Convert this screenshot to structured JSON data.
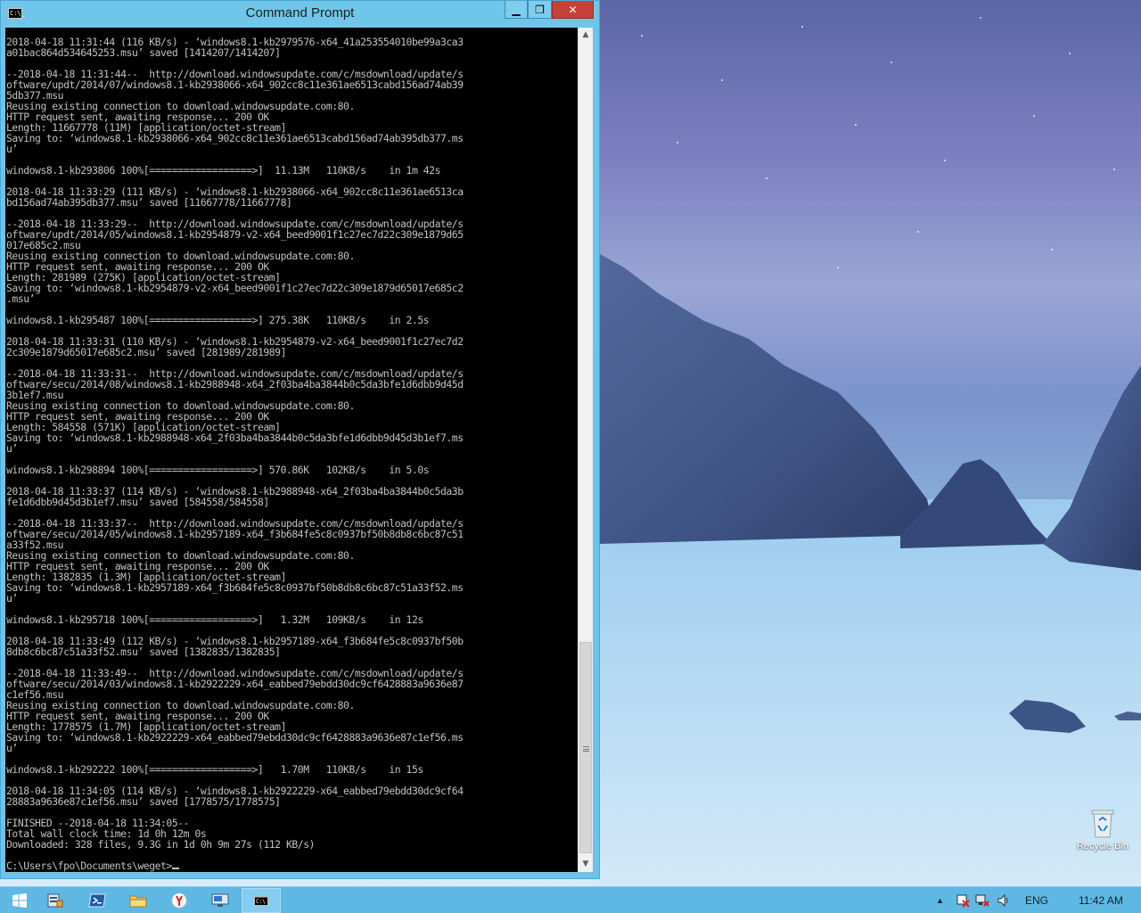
{
  "window": {
    "title": "Command Prompt",
    "icon_label": "C:\\_",
    "controls": {
      "minimize": "▁",
      "maximize": "❐",
      "close": "✕"
    }
  },
  "console": {
    "lines": [
      "2018-04-18 11:31:44 (116 KB/s) - ‘windows8.1-kb2979576-x64_41a253554010be99a3ca3",
      "a01bac864d534645253.msu’ saved [1414207/1414207]",
      "",
      "--2018-04-18 11:31:44--  http://download.windowsupdate.com/c/msdownload/update/s",
      "oftware/updt/2014/07/windows8.1-kb2938066-x64_902cc8c11e361ae6513cabd156ad74ab39",
      "5db377.msu",
      "Reusing existing connection to download.windowsupdate.com:80.",
      "HTTP request sent, awaiting response... 200 OK",
      "Length: 11667778 (11M) [application/octet-stream]",
      "Saving to: ‘windows8.1-kb2938066-x64_902cc8c11e361ae6513cabd156ad74ab395db377.ms",
      "u’",
      "",
      "windows8.1-kb293806 100%[==================>]  11.13M   110KB/s    in 1m 42s",
      "",
      "2018-04-18 11:33:29 (111 KB/s) - ‘windows8.1-kb2938066-x64_902cc8c11e361ae6513ca",
      "bd156ad74ab395db377.msu’ saved [11667778/11667778]",
      "",
      "--2018-04-18 11:33:29--  http://download.windowsupdate.com/c/msdownload/update/s",
      "oftware/updt/2014/05/windows8.1-kb2954879-v2-x64_beed9001f1c27ec7d22c309e1879d65",
      "017e685c2.msu",
      "Reusing existing connection to download.windowsupdate.com:80.",
      "HTTP request sent, awaiting response... 200 OK",
      "Length: 281989 (275K) [application/octet-stream]",
      "Saving to: ‘windows8.1-kb2954879-v2-x64_beed9001f1c27ec7d22c309e1879d65017e685c2",
      ".msu’",
      "",
      "windows8.1-kb295487 100%[==================>] 275.38K   110KB/s    in 2.5s",
      "",
      "2018-04-18 11:33:31 (110 KB/s) - ‘windows8.1-kb2954879-v2-x64_beed9001f1c27ec7d2",
      "2c309e1879d65017e685c2.msu’ saved [281989/281989]",
      "",
      "--2018-04-18 11:33:31--  http://download.windowsupdate.com/c/msdownload/update/s",
      "oftware/secu/2014/08/windows8.1-kb2988948-x64_2f03ba4ba3844b0c5da3bfe1d6dbb9d45d",
      "3b1ef7.msu",
      "Reusing existing connection to download.windowsupdate.com:80.",
      "HTTP request sent, awaiting response... 200 OK",
      "Length: 584558 (571K) [application/octet-stream]",
      "Saving to: ‘windows8.1-kb2988948-x64_2f03ba4ba3844b0c5da3bfe1d6dbb9d45d3b1ef7.ms",
      "u’",
      "",
      "windows8.1-kb298894 100%[==================>] 570.86K   102KB/s    in 5.0s",
      "",
      "2018-04-18 11:33:37 (114 KB/s) - ‘windows8.1-kb2988948-x64_2f03ba4ba3844b0c5da3b",
      "fe1d6dbb9d45d3b1ef7.msu’ saved [584558/584558]",
      "",
      "--2018-04-18 11:33:37--  http://download.windowsupdate.com/c/msdownload/update/s",
      "oftware/secu/2014/05/windows8.1-kb2957189-x64_f3b684fe5c8c0937bf50b8db8c6bc87c51",
      "a33f52.msu",
      "Reusing existing connection to download.windowsupdate.com:80.",
      "HTTP request sent, awaiting response... 200 OK",
      "Length: 1382835 (1.3M) [application/octet-stream]",
      "Saving to: ‘windows8.1-kb2957189-x64_f3b684fe5c8c0937bf50b8db8c6bc87c51a33f52.ms",
      "u’",
      "",
      "windows8.1-kb295718 100%[==================>]   1.32M   109KB/s    in 12s",
      "",
      "2018-04-18 11:33:49 (112 KB/s) - ‘windows8.1-kb2957189-x64_f3b684fe5c8c0937bf50b",
      "8db8c6bc87c51a33f52.msu’ saved [1382835/1382835]",
      "",
      "--2018-04-18 11:33:49--  http://download.windowsupdate.com/c/msdownload/update/s",
      "oftware/secu/2014/03/windows8.1-kb2922229-x64_eabbed79ebdd30dc9cf6428883a9636e87",
      "c1ef56.msu",
      "Reusing existing connection to download.windowsupdate.com:80.",
      "HTTP request sent, awaiting response... 200 OK",
      "Length: 1778575 (1.7M) [application/octet-stream]",
      "Saving to: ‘windows8.1-kb2922229-x64_eabbed79ebdd30dc9cf6428883a9636e87c1ef56.ms",
      "u’",
      "",
      "windows8.1-kb292222 100%[==================>]   1.70M   110KB/s    in 15s",
      "",
      "2018-04-18 11:34:05 (114 KB/s) - ‘windows8.1-kb2922229-x64_eabbed79ebdd30dc9cf64",
      "28883a9636e87c1ef56.msu’ saved [1778575/1778575]",
      "",
      "FINISHED --2018-04-18 11:34:05--",
      "Total wall clock time: 1d 0h 12m 0s",
      "Downloaded: 328 files, 9.3G in 1d 0h 9m 27s (112 KB/s)",
      ""
    ],
    "prompt": "C:\\Users\\fpo\\Documents\\weget>"
  },
  "desktop": {
    "recycle_bin_label": "Recycle Bin"
  },
  "taskbar": {
    "buttons": [
      {
        "name": "start-button",
        "icon": "windows-logo-icon"
      },
      {
        "name": "server-manager-button",
        "icon": "server-manager-icon"
      },
      {
        "name": "powershell-button",
        "icon": "powershell-icon"
      },
      {
        "name": "file-explorer-button",
        "icon": "folder-icon"
      },
      {
        "name": "yandex-browser-button",
        "icon": "yandex-icon"
      },
      {
        "name": "remote-desktop-button",
        "icon": "remote-desktop-icon"
      },
      {
        "name": "command-prompt-taskbar-button",
        "icon": "cmd-icon",
        "active": true
      }
    ],
    "tray": {
      "language": "ENG",
      "time": "11:42 AM"
    }
  },
  "colors": {
    "taskbar": "#5fb7e3",
    "titlebar": "#6fc6ea",
    "close_button": "#c7403a",
    "console_bg": "#000000",
    "console_fg": "#c0c0c0"
  }
}
